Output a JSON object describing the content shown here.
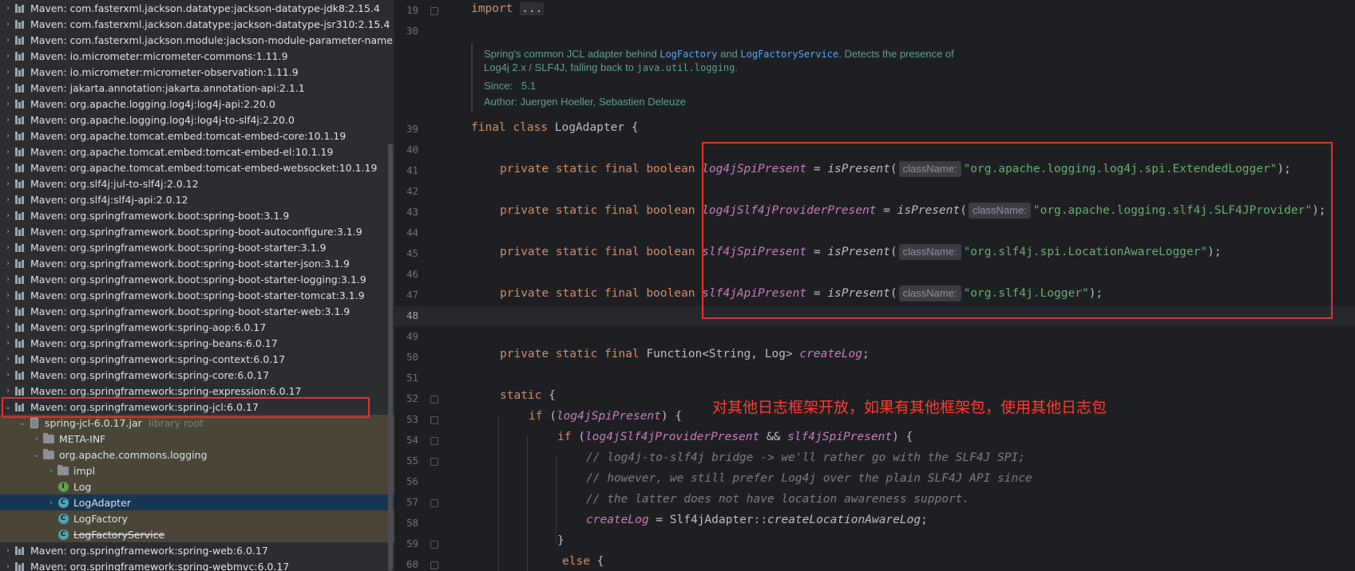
{
  "tree": {
    "items": [
      {
        "label": "Maven: com.fasterxml.jackson.datatype:jackson-datatype-jdk8:2.15.4",
        "arrow": "›"
      },
      {
        "label": "Maven: com.fasterxml.jackson.datatype:jackson-datatype-jsr310:2.15.4",
        "arrow": "›"
      },
      {
        "label": "Maven: com.fasterxml.jackson.module:jackson-module-parameter-name",
        "arrow": "›"
      },
      {
        "label": "Maven: io.micrometer:micrometer-commons:1.11.9",
        "arrow": "›"
      },
      {
        "label": "Maven: io.micrometer:micrometer-observation:1.11.9",
        "arrow": "›"
      },
      {
        "label": "Maven: jakarta.annotation:jakarta.annotation-api:2.1.1",
        "arrow": "›"
      },
      {
        "label": "Maven: org.apache.logging.log4j:log4j-api:2.20.0",
        "arrow": "›"
      },
      {
        "label": "Maven: org.apache.logging.log4j:log4j-to-slf4j:2.20.0",
        "arrow": "›"
      },
      {
        "label": "Maven: org.apache.tomcat.embed:tomcat-embed-core:10.1.19",
        "arrow": "›"
      },
      {
        "label": "Maven: org.apache.tomcat.embed:tomcat-embed-el:10.1.19",
        "arrow": "›"
      },
      {
        "label": "Maven: org.apache.tomcat.embed:tomcat-embed-websocket:10.1.19",
        "arrow": "›"
      },
      {
        "label": "Maven: org.slf4j:jul-to-slf4j:2.0.12",
        "arrow": "›"
      },
      {
        "label": "Maven: org.slf4j:slf4j-api:2.0.12",
        "arrow": "›"
      },
      {
        "label": "Maven: org.springframework.boot:spring-boot:3.1.9",
        "arrow": "›"
      },
      {
        "label": "Maven: org.springframework.boot:spring-boot-autoconfigure:3.1.9",
        "arrow": "›"
      },
      {
        "label": "Maven: org.springframework.boot:spring-boot-starter:3.1.9",
        "arrow": "›"
      },
      {
        "label": "Maven: org.springframework.boot:spring-boot-starter-json:3.1.9",
        "arrow": "›"
      },
      {
        "label": "Maven: org.springframework.boot:spring-boot-starter-logging:3.1.9",
        "arrow": "›"
      },
      {
        "label": "Maven: org.springframework.boot:spring-boot-starter-tomcat:3.1.9",
        "arrow": "›"
      },
      {
        "label": "Maven: org.springframework.boot:spring-boot-starter-web:3.1.9",
        "arrow": "›"
      },
      {
        "label": "Maven: org.springframework:spring-aop:6.0.17",
        "arrow": "›"
      },
      {
        "label": "Maven: org.springframework:spring-beans:6.0.17",
        "arrow": "›"
      },
      {
        "label": "Maven: org.springframework:spring-context:6.0.17",
        "arrow": "›"
      },
      {
        "label": "Maven: org.springframework:spring-core:6.0.17",
        "arrow": "›"
      },
      {
        "label": "Maven: org.springframework:spring-expression:6.0.17",
        "arrow": "›"
      },
      {
        "label": "Maven: org.springframework:spring-jcl:6.0.17",
        "arrow": "⌄"
      }
    ],
    "jar": {
      "label": "spring-jcl-6.0.17.jar",
      "suffix": "library root",
      "arrow": "⌄"
    },
    "meta_inf": {
      "label": "META-INF",
      "arrow": "›"
    },
    "package": {
      "label": "org.apache.commons.logging",
      "arrow": "⌄"
    },
    "impl": {
      "label": "impl",
      "arrow": "›"
    },
    "log": {
      "label": "Log",
      "icon": "I"
    },
    "log_adapter": {
      "label": "LogAdapter",
      "icon": "C",
      "arrow": "›"
    },
    "log_factory": {
      "label": "LogFactory",
      "icon": "C"
    },
    "log_factory_service": {
      "label": "LogFactoryService",
      "icon": "C"
    },
    "tail": [
      {
        "label": "Maven: org.springframework:spring-web:6.0.17",
        "arrow": "›"
      },
      {
        "label": "Maven: org.springframework:spring-webmvc:6.0.17",
        "arrow": "›"
      }
    ]
  },
  "editor": {
    "line_numbers": {
      "l19": "19",
      "l30": "30",
      "l39": "39",
      "l40": "40",
      "l41": "41",
      "l42": "42",
      "l43": "43",
      "l44": "44",
      "l45": "45",
      "l46": "46",
      "l47": "47",
      "l48": "48",
      "l49": "49",
      "l50": "50",
      "l51": "51",
      "l52": "52",
      "l53": "53",
      "l54": "54",
      "l55": "55",
      "l56": "56",
      "l57": "57",
      "l58": "58",
      "l59": "59",
      "l60": "60"
    },
    "import_kw": "import",
    "import_fold": "...",
    "doc": {
      "line1_a": "Spring's common JCL adapter behind ",
      "line1_link1": "LogFactory",
      "line1_b": " and ",
      "line1_link2": "LogFactoryService",
      "line1_c": ". Detects the presence of",
      "line2_a": "Log4j 2.x / SLF4J, falling back to ",
      "line2_code": "java.util.logging",
      "line2_b": ".",
      "since_label": "Since:",
      "since_value": "5.1",
      "author_label": "Author:",
      "author_value": "Juergen Hoeller, Sebastien Deleuze"
    },
    "class_decl": {
      "mods": "final class",
      "name": "LogAdapter",
      "brace": "{"
    },
    "decl_prefix": "private static final boolean",
    "hint_label": "className:",
    "is_present": "isPresent",
    "fields": [
      {
        "name": "log4jSpiPresent",
        "value": "\"org.apache.logging.log4j.spi.ExtendedLogger\""
      },
      {
        "name": "log4jSlf4jProviderPresent",
        "value": "\"org.apache.logging.slf4j.SLF4JProvider\""
      },
      {
        "name": "slf4jSpiPresent",
        "value": "\"org.slf4j.spi.LocationAwareLogger\""
      },
      {
        "name": "slf4jApiPresent",
        "value": "\"org.slf4j.Logger\""
      }
    ],
    "fn_prefix": "private static final",
    "fn_type": "Function<String, Log>",
    "fn_name": "createLog",
    "static_kw": "static",
    "if_kw": "if",
    "else_kw": "else",
    "comments": [
      "// log4j-to-slf4j bridge -> we'll rather go with the SLF4J SPI;",
      "// however, we still prefer Log4j over the plain SLF4J API since",
      "// the latter does not have location awareness support."
    ],
    "assign_target": "createLog",
    "assign_class": "Slf4jAdapter",
    "assign_method": "createLocationAwareLog",
    "annotation": "对其他日志框架开放，如果有其他框架包，使用其他日志包"
  },
  "colors": {
    "highlight_box": "#e5312a",
    "annotation_text": "#ff3b30"
  }
}
